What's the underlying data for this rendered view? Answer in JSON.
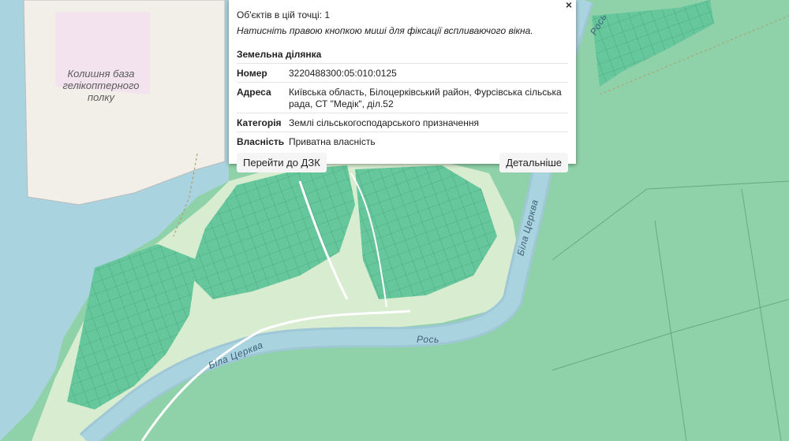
{
  "map": {
    "labels": {
      "base": "Колишня база гелікоптерного полку",
      "river_ros_1": "Рось",
      "river_ros_2": "Рось",
      "river_bila_tserkva_1": "Біла Церква",
      "river_bila_tserkva_2": "Біла Церква"
    },
    "colors": {
      "water": "#a9d3de",
      "forest": "#8fd1a8",
      "parcel": "#66c79c",
      "road": "#ffffff",
      "military": "#f3e3ee"
    }
  },
  "popup": {
    "close_label": "×",
    "count": "Об'єктів в цій точці: 1",
    "hint": "Натисніть правою кнопкою миші для фіксації вспливаючого вікна.",
    "section_title": "Земельна ділянка",
    "rows": [
      {
        "key": "Номер",
        "value": "3220488300:05:010:0125"
      },
      {
        "key": "Адреса",
        "value": "Київська область, Білоцерківський район, Фурсівська сільська рада, СТ \"Медік\", діл.52"
      },
      {
        "key": "Категорія",
        "value": "Землі сільськогосподарського призначення"
      },
      {
        "key": "Власність",
        "value": "Приватна власність"
      }
    ],
    "btn_dzk": "Перейти до ДЗК",
    "btn_details": "Детальніше"
  }
}
